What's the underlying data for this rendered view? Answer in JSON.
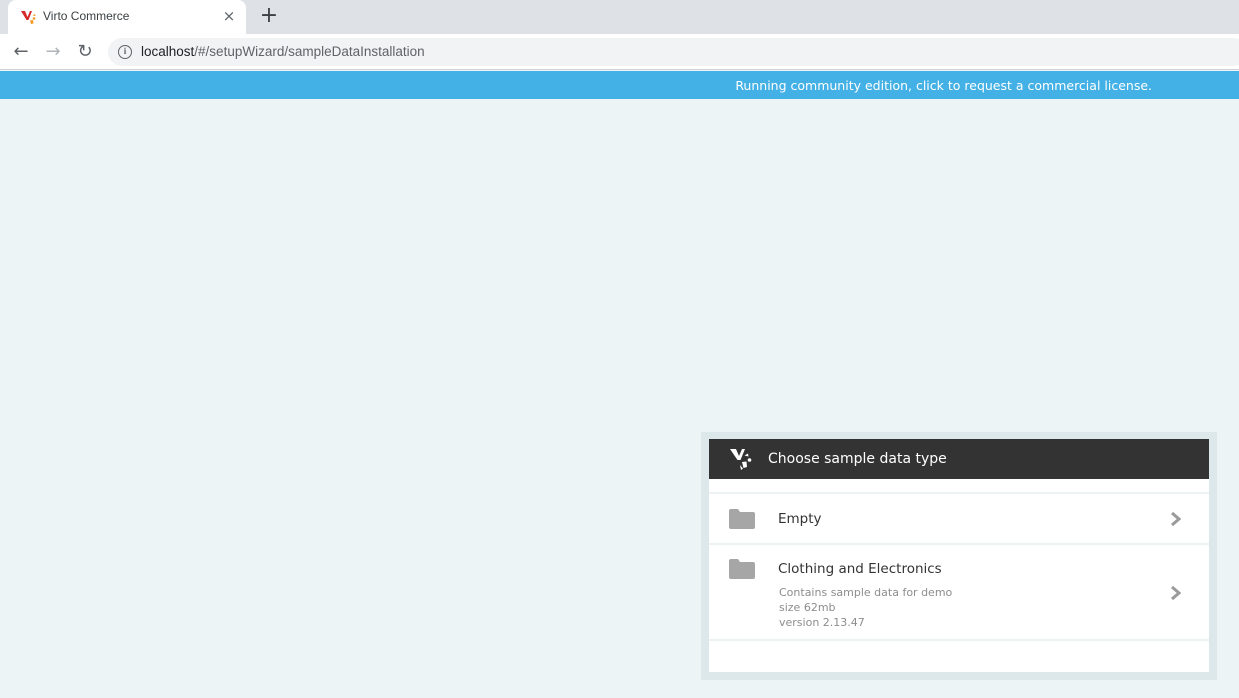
{
  "browser": {
    "tab_title": "Virto Commerce",
    "tab_close_glyph": "×",
    "new_tab_glyph": "+",
    "back_glyph": "←",
    "forward_glyph": "→",
    "reload_glyph": "↻",
    "info_glyph": "i",
    "url_host": "localhost",
    "url_path": "/#/setupWizard/sampleDataInstallation"
  },
  "license_banner": {
    "text": "Running community edition, click to request a commercial license.",
    "color": "#43b0e6"
  },
  "wizard": {
    "title": "Choose sample data type",
    "header_color": "#333333",
    "items": [
      {
        "name": "Empty",
        "icon": "folder-icon"
      },
      {
        "name": "Clothing and Electronics",
        "icon": "folder-icon",
        "description": "Contains sample data for demo",
        "size": "size 62mb",
        "version": "version 2.13.47"
      }
    ]
  }
}
